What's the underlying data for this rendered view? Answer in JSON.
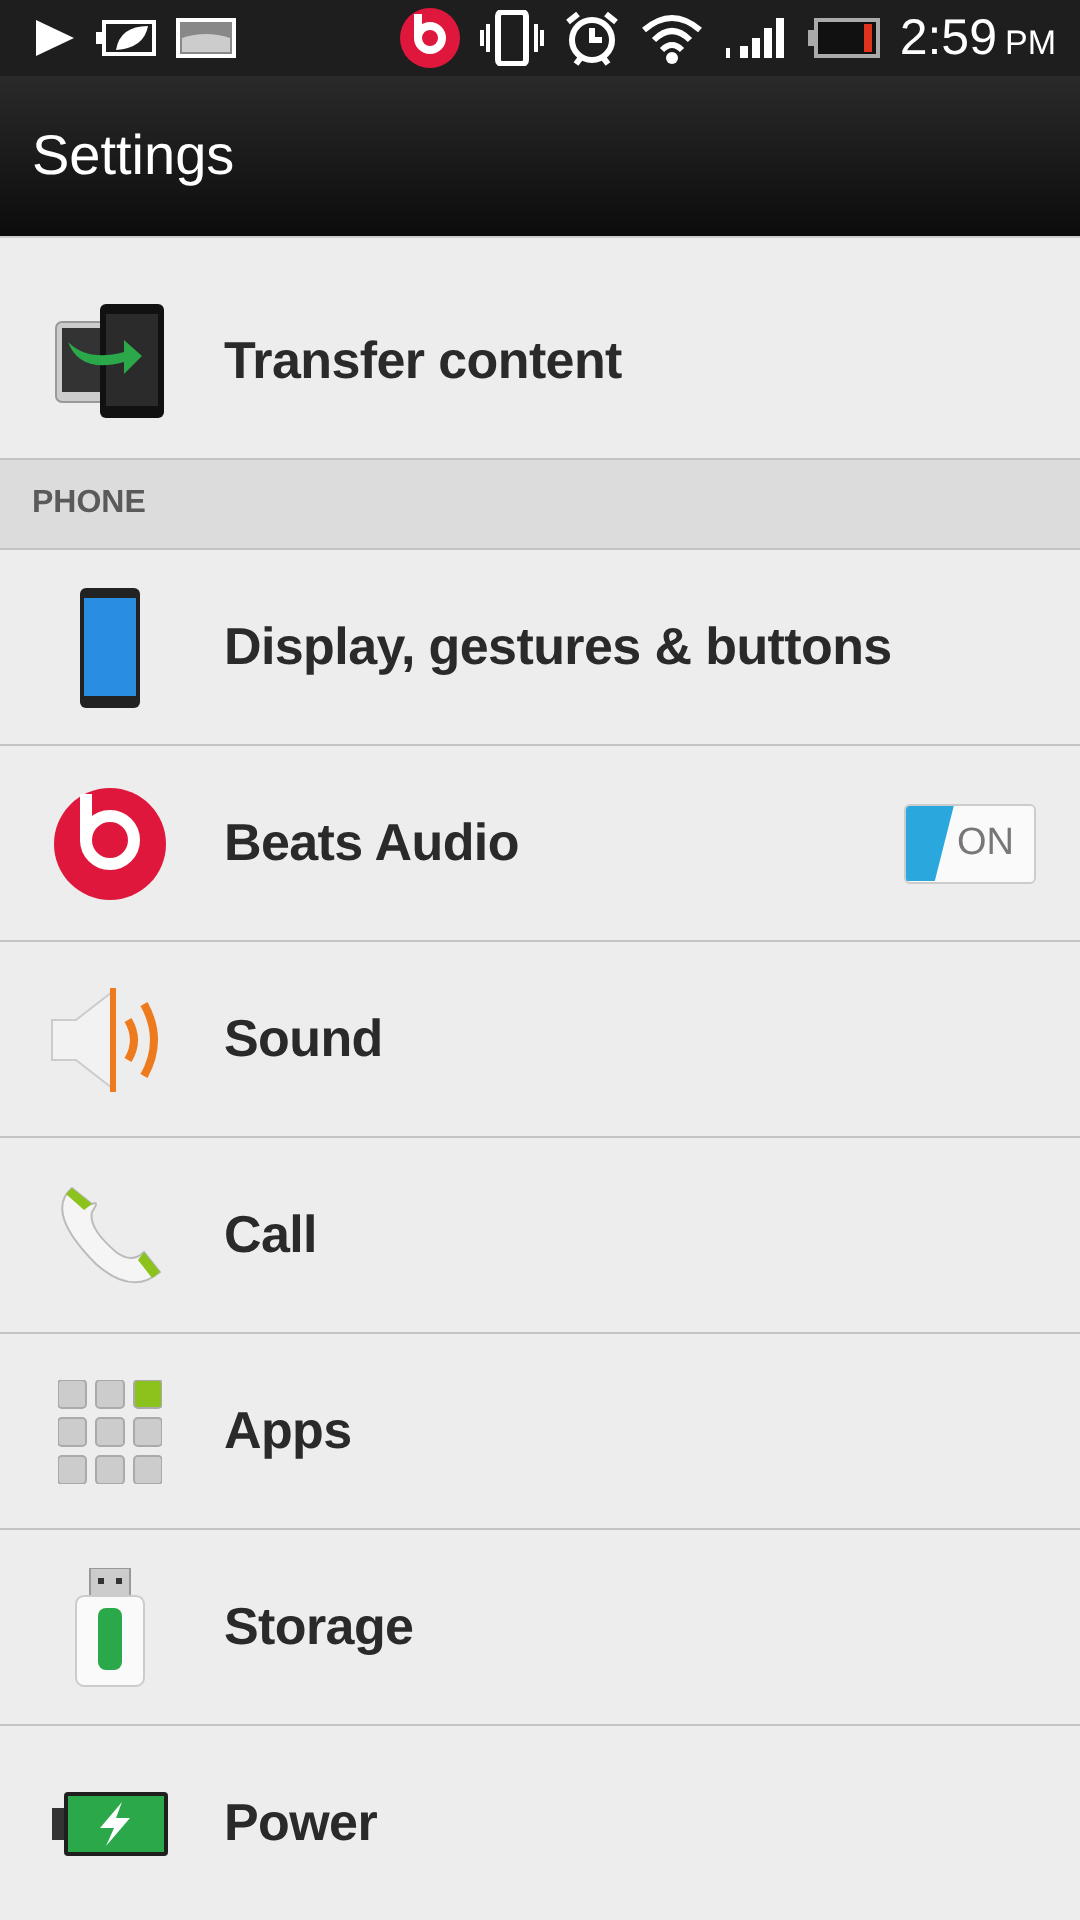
{
  "status_bar": {
    "time": "2:59",
    "ampm": "PM"
  },
  "title_bar": {
    "title": "Settings"
  },
  "list": [
    {
      "kind": "item",
      "label": "Transfer content"
    },
    {
      "kind": "header",
      "label": "PHONE"
    },
    {
      "kind": "item",
      "label": "Display, gestures & buttons"
    },
    {
      "kind": "item",
      "label": "Beats Audio",
      "toggle": {
        "on": true,
        "text": "ON"
      }
    },
    {
      "kind": "item",
      "label": "Sound"
    },
    {
      "kind": "item",
      "label": "Call"
    },
    {
      "kind": "item",
      "label": "Apps"
    },
    {
      "kind": "item",
      "label": "Storage"
    },
    {
      "kind": "item",
      "label": "Power"
    }
  ]
}
